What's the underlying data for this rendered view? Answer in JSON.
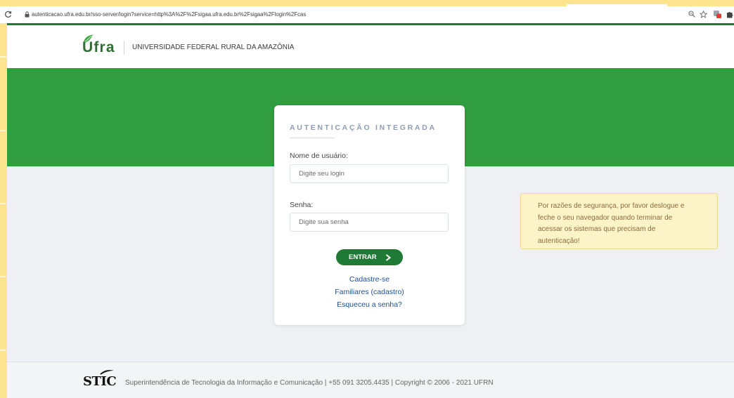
{
  "browser": {
    "url": "autenticacao.ufra.edu.br/sso-server/login?service=http%3A%2F%2Fsigaa.ufra.edu.br%2Fsigaa%2Flogin%2Fcas",
    "icons": {
      "reload": "reload-icon",
      "lock": "lock-icon",
      "zoom": "zoom-icon",
      "bookmark": "star-icon",
      "extension": "extension-icon",
      "extensions_menu": "puzzle-icon"
    }
  },
  "header": {
    "logo_text": "Ufra",
    "logo_icon": "leaf-icon",
    "institution": "UNIVERSIDADE FEDERAL RURAL DA AMAZÔNIA"
  },
  "login": {
    "title": "AUTENTICAÇÃO INTEGRADA",
    "username": {
      "label": "Nome de usuário:",
      "placeholder": "Digite seu login",
      "value": ""
    },
    "password": {
      "label": "Senha:",
      "placeholder": "Digite sua senha",
      "value": ""
    },
    "submit": {
      "label": "ENTRAR",
      "icon": "chevron-right-icon"
    },
    "links": [
      "Cadastre-se",
      "Familiares (cadastro)",
      "Esqueceu a senha?"
    ]
  },
  "notice": {
    "lines": [
      "Por razões de segurança, por favor deslogue e",
      "feche o seu navegador quando terminar de",
      "acessar os sistemas que precisam de",
      "autenticação!"
    ]
  },
  "footer": {
    "logo_text": "STIC",
    "text": "Superintendência de Tecnologia da Informação e Comunicação | +55 091 3205.4435 | Copyright © 2006 - 2021 UFRN"
  },
  "colors": {
    "frame": "#fde58f",
    "brand_green": "#2f9d40",
    "button_green": "#1f7a36",
    "link_blue": "#1e4f8d",
    "title_gray_blue": "#8d9db4",
    "notice_background": "#fdf3c8",
    "notice_text": "#8a6d3b",
    "page_background": "#eef0f3"
  }
}
